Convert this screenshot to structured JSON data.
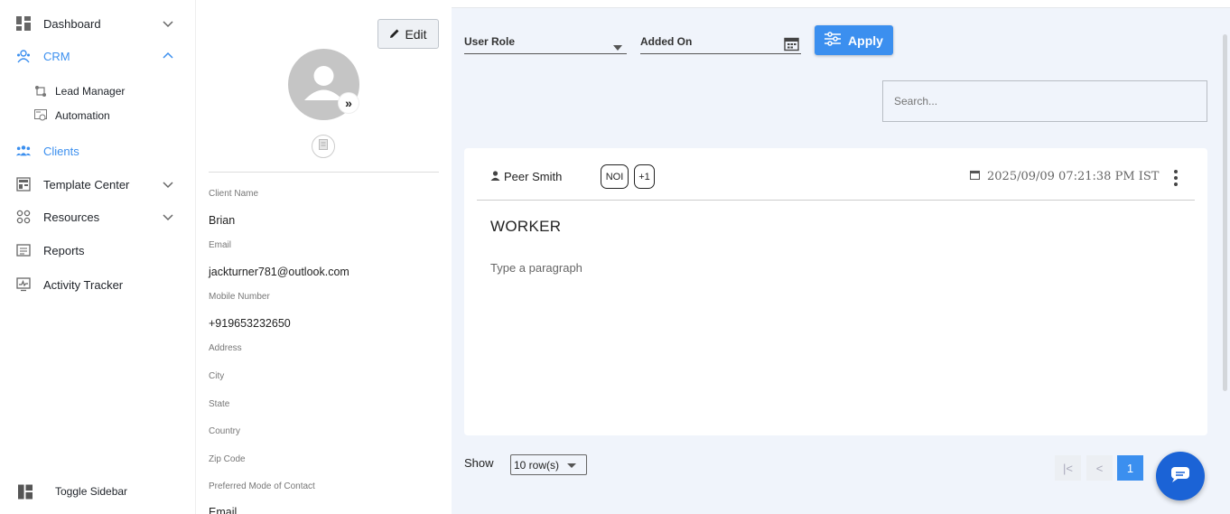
{
  "sidebar": {
    "dashboard": "Dashboard",
    "crm": "CRM",
    "lead_manager": "Lead Manager",
    "automation": "Automation",
    "clients": "Clients",
    "template_center": "Template Center",
    "resources": "Resources",
    "reports": "Reports",
    "activity_tracker": "Activity Tracker",
    "toggle_sidebar": "Toggle Sidebar"
  },
  "profile": {
    "edit_label": "Edit",
    "avatar_toggle": "»",
    "fields": {
      "client_name_label": "Client Name",
      "client_name_value": "Brian",
      "email_label": "Email",
      "email_value": "jackturner781@outlook.com",
      "mobile_label": "Mobile Number",
      "mobile_value": "+919653232650",
      "address_label": "Address",
      "city_label": "City",
      "state_label": "State",
      "country_label": "Country",
      "zip_label": "Zip Code",
      "preferred_label": "Preferred Mode of Contact",
      "preferred_value": "Email"
    }
  },
  "filters": {
    "user_role": "User Role",
    "added_on": "Added On",
    "apply": "Apply"
  },
  "search": {
    "placeholder": "Search..."
  },
  "card": {
    "author": "Peer Smith",
    "tags": [
      "NOI",
      "+1"
    ],
    "date": "2025/09/09 07:21:38 PM IST",
    "title": "WORKER",
    "paragraph": "Type a paragraph"
  },
  "pagination": {
    "show_label": "Show",
    "rows_value": "10 row(s)",
    "current_page": "1",
    "first_icon": "|<",
    "prev_icon": "<"
  },
  "colors": {
    "accent": "#3b8fef",
    "chat": "#1b63d6",
    "background": "#f0f4fb"
  }
}
